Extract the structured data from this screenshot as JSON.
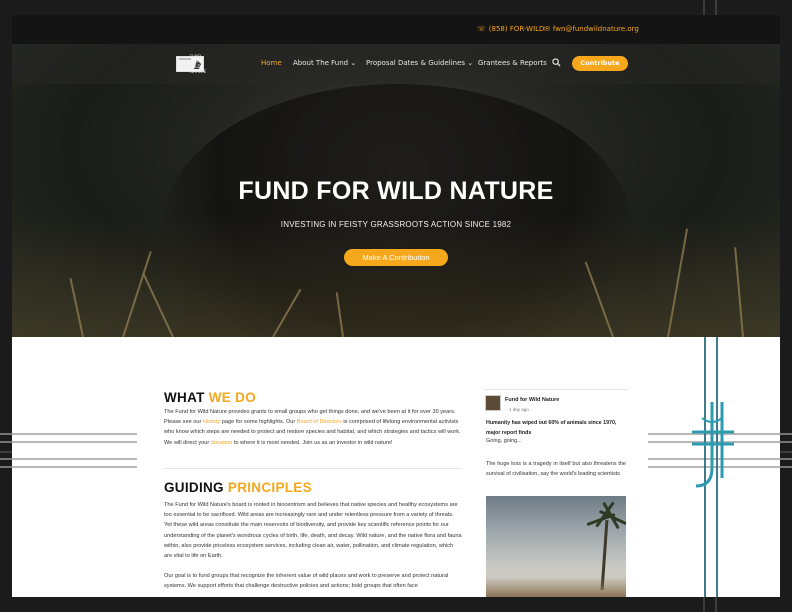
{
  "topbar": {
    "phone": "(858) FOR-WILD",
    "email": "fwn@fundwildnature.org"
  },
  "nav": {
    "logo_text": "FUND FOR WILD NATURE",
    "items": [
      "Home",
      "About The Fund",
      "Proposal Dates & Guidelines",
      "Grantees & Reports"
    ],
    "contribute_label": "Contribute"
  },
  "hero": {
    "title": "FUND FOR WILD NATURE",
    "subtitle": "INVESTING IN FEISTY GRASSROOTS ACTION SINCE 1982",
    "button_label": "Make A Contribution"
  },
  "what_we_do": {
    "heading_a": "WHAT ",
    "heading_b": "WE DO",
    "p1": "The Fund for Wild Nature provides grants to small groups who get things done, and we've been at it for over 30 years. Please see our ",
    "link1": "History",
    "p2": " page for some highlights. Our ",
    "link2": "Board of Directors",
    "p3": " is comprised of lifelong environmental activists who know which steps are needed to protect and restore species and habitat, and which strategies and tactics will work. We will direct your ",
    "link3": "donation",
    "p4": " to where it is most needed.  Join us as an investor in wild nature!"
  },
  "guiding": {
    "heading_a": "GUIDING ",
    "heading_b": "PRINCIPLES",
    "p1": "The Fund for Wild Nature's board is rooted in biocentrism and believes that native species and healthy ecosystems are too essential to be sacrificed. Wild areas are increasingly rare and under relentless pressure from a variety of threats. Yet these wild areas constitute the main reservoirs of biodiversity, and provide key scientific reference points for our understanding of the planet's wondrous cycles of birth, life, death, and decay. Wild nature, and the native flora and fauna within, also provide priceless ecosystem services, including clean air, water, pollination, and climate regulation, which are vital to life on Earth.",
    "p2": "Our goal is to fund groups that recognize the inherent value of wild places and work to preserve and protect natural systems. We support efforts that challenge destructive policies and actions; bold groups that often face"
  },
  "facebook": {
    "page_name": "Fund for Wild Nature",
    "time": "1 day ago",
    "headline": "Humanity has wiped out 60% of animals since 1970, major report finds",
    "going": "Going, going...",
    "body": "The huge loss is a tragedy in itself but also threatens the survival of civilisation, say the world's leading scientists"
  },
  "colors": {
    "accent": "#f6a71c",
    "topbar": "#141414",
    "overlay_teal": "#2c6e7d"
  },
  "icons": [
    "phone-icon",
    "envelope-icon",
    "chevron-down-icon",
    "search-icon"
  ]
}
